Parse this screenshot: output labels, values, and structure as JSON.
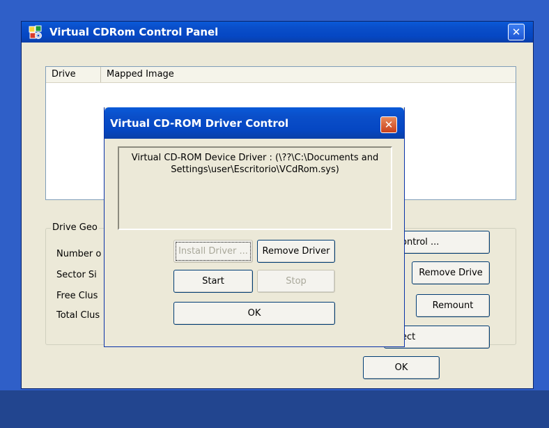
{
  "main_window": {
    "title": "Virtual CDRom Control Panel",
    "close_glyph": "✕",
    "columns": [
      "Drive",
      "Mapped Image"
    ],
    "drive_geometry": {
      "group_label": "Drive Geo",
      "fields": [
        "Number o",
        "Sector Si",
        "Free Clus",
        "Total Clus"
      ]
    },
    "buttons": {
      "driver_control": "ontrol ...",
      "remove_drive": "Remove Drive",
      "remount": "Remount",
      "eject": "ect",
      "ok": "OK"
    }
  },
  "dialog": {
    "title": "Virtual CD-ROM Driver Control",
    "close_glyph": "✕",
    "status_text": "Virtual CD-ROM Device Driver : (\\??\\C:\\Documents and Settings\\user\\Escritorio\\VCdRom.sys)",
    "buttons": {
      "install": "Install Driver ...",
      "remove": "Remove Driver",
      "start": "Start",
      "stop": "Stop",
      "ok": "OK"
    }
  },
  "icons": {
    "app_icon": "cd-rom-app-icon",
    "close": "close-icon"
  },
  "colors": {
    "titlebar_blue": "#0a4ec9",
    "close_red": "#c9401b",
    "window_face": "#ece9d8",
    "desktop_blue": "#2f5fc8"
  }
}
